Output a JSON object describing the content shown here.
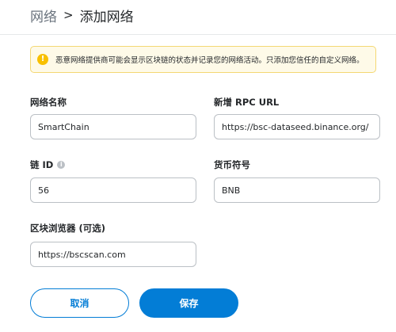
{
  "header": {
    "parent": "网络",
    "separator": ">",
    "current": "添加网络"
  },
  "warning": {
    "icon": "exclamation-icon",
    "text": "恶意网络提供商可能会显示区块链的状态并记录您的网络活动。只添加您信任的自定义网络。"
  },
  "form": {
    "network_name": {
      "label": "网络名称",
      "value": "SmartChain"
    },
    "rpc_url": {
      "label": "新增 RPC URL",
      "value": "https://bsc-dataseed.binance.org/"
    },
    "chain_id": {
      "label": "链 ID",
      "info_icon": "i",
      "value": "56"
    },
    "currency_symbol": {
      "label": "货币符号",
      "value": "BNB"
    },
    "block_explorer": {
      "label": "区块浏览器 (可选)",
      "value": "https://bscscan.com"
    }
  },
  "buttons": {
    "cancel": "取消",
    "save": "保存"
  },
  "colors": {
    "accent": "#037dd6",
    "warning_bg": "#fefae8",
    "warning_border": "#f4d873",
    "warning_icon": "#f8c000"
  }
}
